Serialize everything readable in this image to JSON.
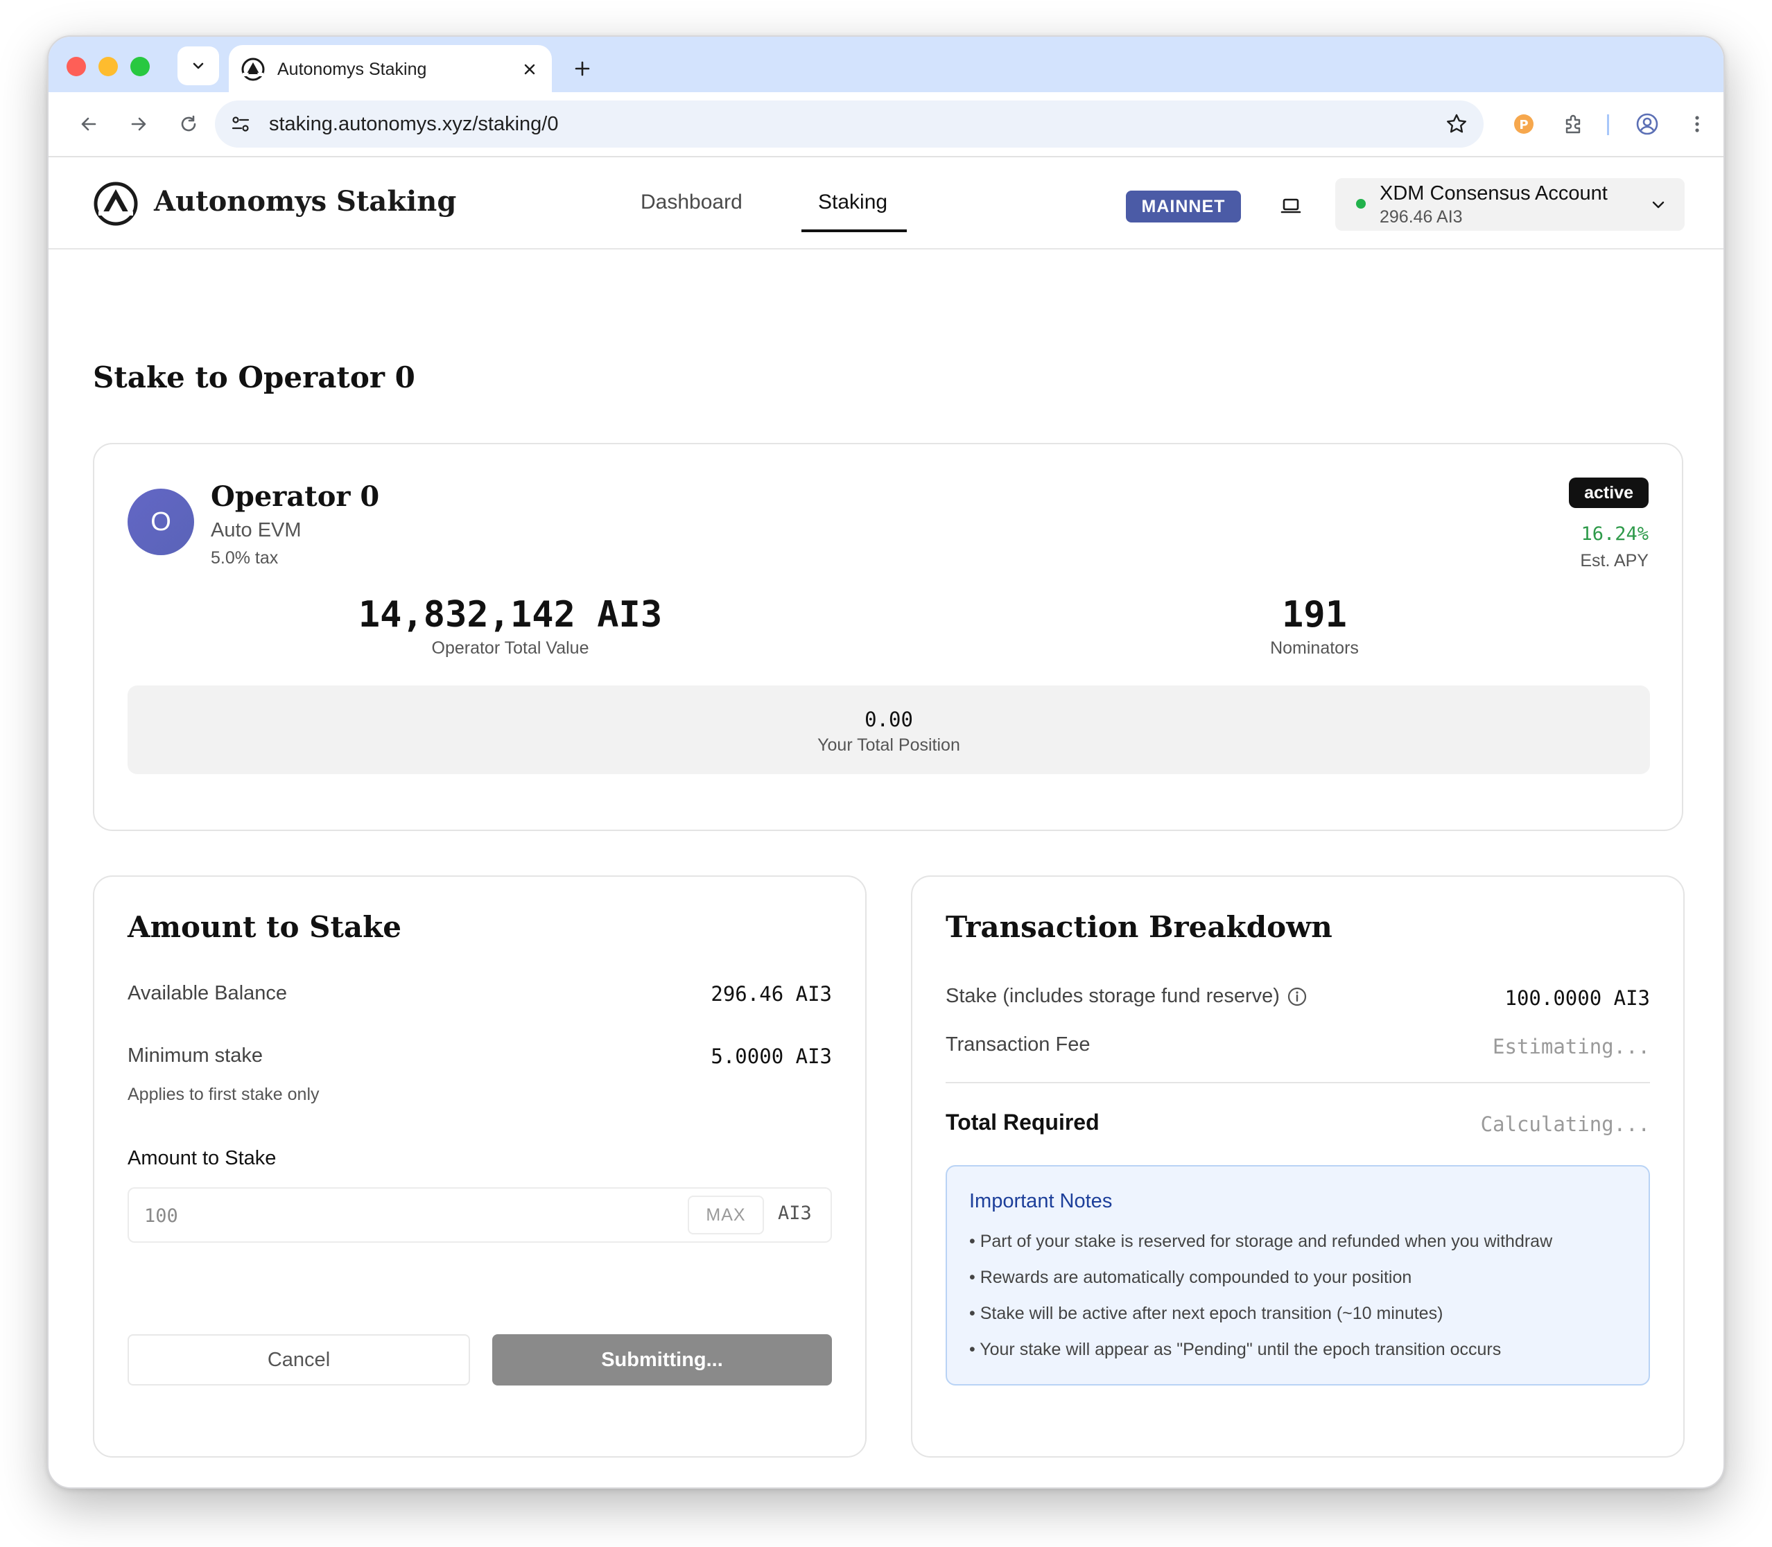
{
  "browser": {
    "tab_title": "Autonomys Staking",
    "url": "staking.autonomys.xyz/staking/0"
  },
  "header": {
    "brand": "Autonomys Staking",
    "nav": [
      "Dashboard",
      "Staking"
    ],
    "active_nav": "Staking",
    "network_badge": "MAINNET",
    "account": {
      "name": "XDM Consensus Account",
      "balance": "296.46 AI3",
      "status_color": "#22b24c"
    }
  },
  "page": {
    "title": "Stake to Operator 0"
  },
  "operator": {
    "avatar_letter": "O",
    "name": "Operator 0",
    "domain": "Auto EVM",
    "tax": "5.0% tax",
    "status": "active",
    "apy": "16.24%",
    "apy_label": "Est. APY",
    "total_value": "14,832,142 AI3",
    "total_value_label": "Operator Total Value",
    "nominators": "191",
    "nominators_label": "Nominators",
    "position": "0.00",
    "position_label": "Your Total Position"
  },
  "stake_form": {
    "title": "Amount to Stake",
    "available_label": "Available Balance",
    "available_value": "296.46 AI3",
    "min_label": "Minimum stake",
    "min_value": "5.0000 AI3",
    "min_note": "Applies to first stake only",
    "amount_label": "Amount to Stake",
    "amount_placeholder": "100",
    "max_label": "MAX",
    "unit": "AI3",
    "cancel_label": "Cancel",
    "submit_label": "Submitting..."
  },
  "breakdown": {
    "title": "Transaction Breakdown",
    "stake_label": "Stake (includes storage fund reserve)",
    "stake_value": "100.0000 AI3",
    "fee_label": "Transaction Fee",
    "fee_value": "Estimating...",
    "total_label": "Total Required",
    "total_value": "Calculating...",
    "notes_title": "Important Notes",
    "notes": [
      "• Part of your stake is reserved for storage and refunded when you withdraw",
      "• Rewards are automatically compounded to your position",
      "• Stake will be active after next epoch transition (~10 minutes)",
      "• Your stake will appear as \"Pending\" until the epoch transition occurs"
    ]
  },
  "colors": {
    "network_badge": "#4b5ba6",
    "apy": "#2e9a4a",
    "notes_bg": "#eef4fe",
    "notes_title": "#1d3f9a",
    "submit_disabled": "#8a8a8a"
  }
}
